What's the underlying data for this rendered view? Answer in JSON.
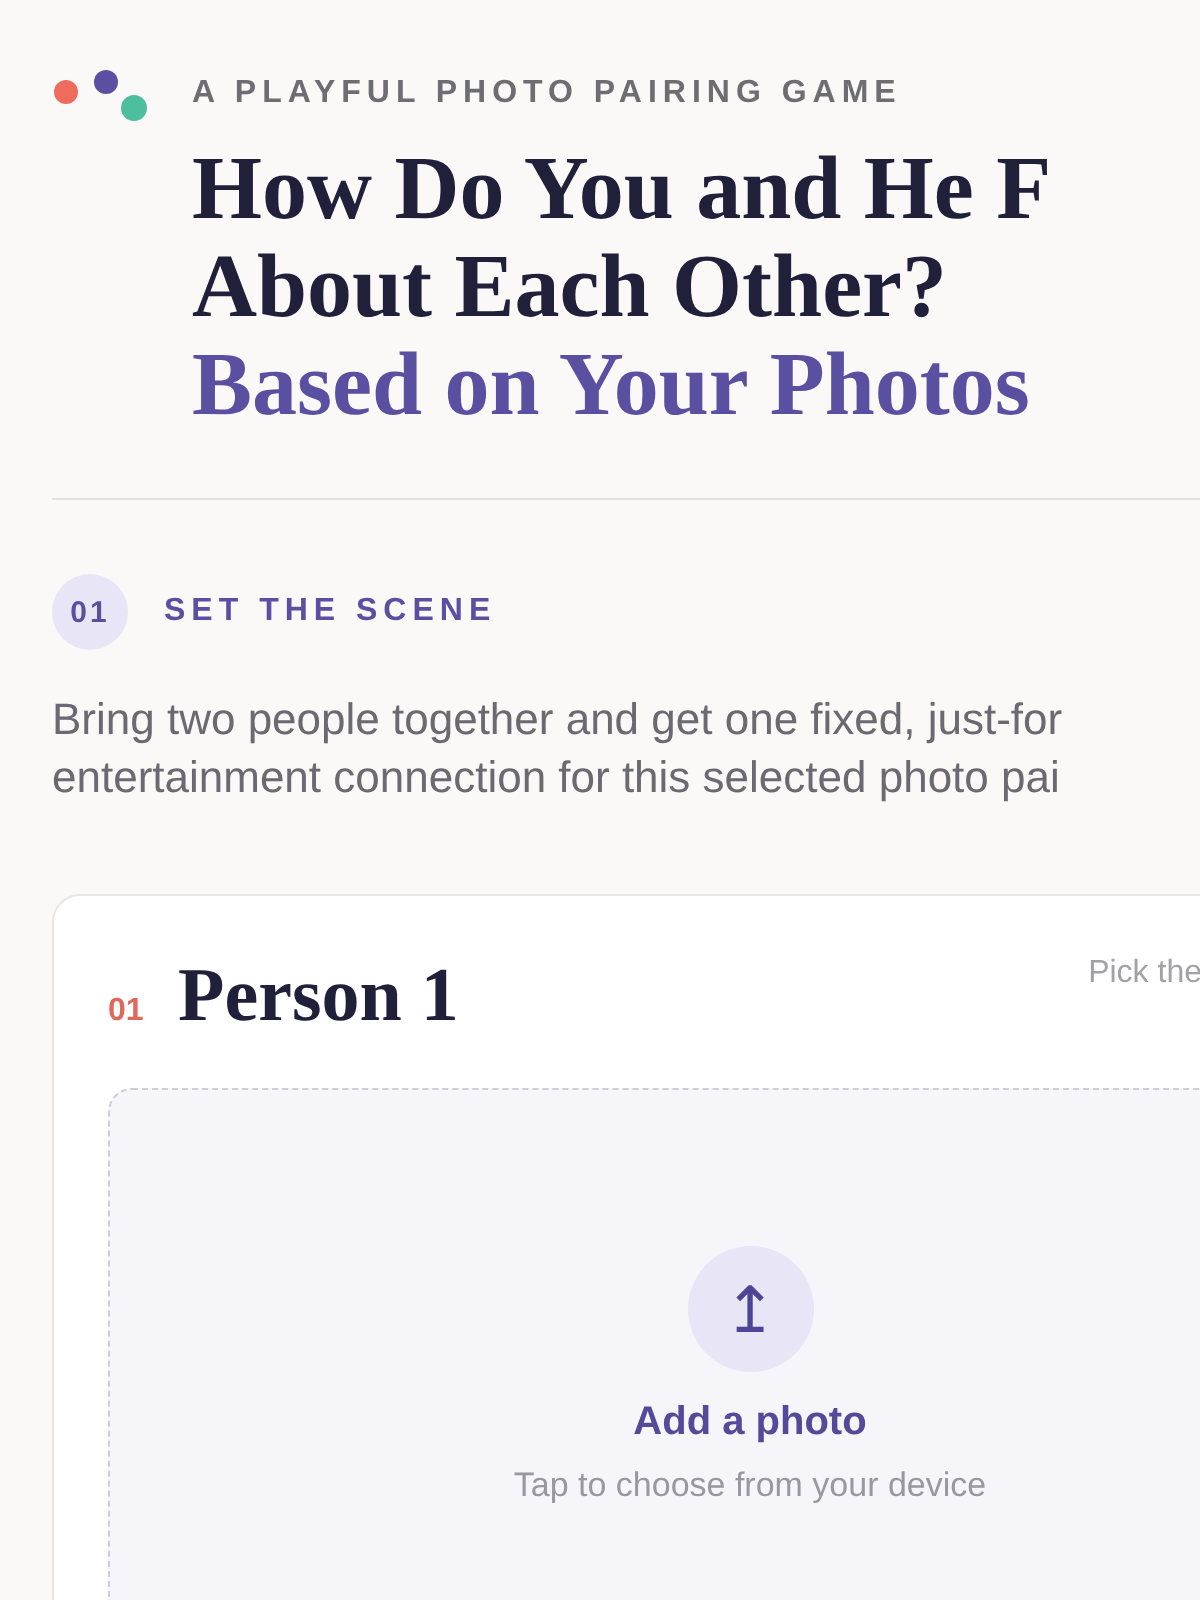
{
  "header": {
    "eyebrow": "A PLAYFUL PHOTO PAIRING GAME",
    "title_lines": [
      "How Do You and He F",
      "About Each Other?"
    ],
    "title_accent": "Based on Your Photos"
  },
  "step": {
    "number": "01",
    "label": "SET THE SCENE"
  },
  "intro": "Bring two people together and get one fixed, just-for entertainment connection for this selected photo pai",
  "person_card": {
    "number": "01",
    "name": "Person 1",
    "hint": "Pick the",
    "upload": {
      "icon": "↥",
      "title": "Add a photo",
      "subtitle": "Tap to choose from your device"
    }
  }
}
